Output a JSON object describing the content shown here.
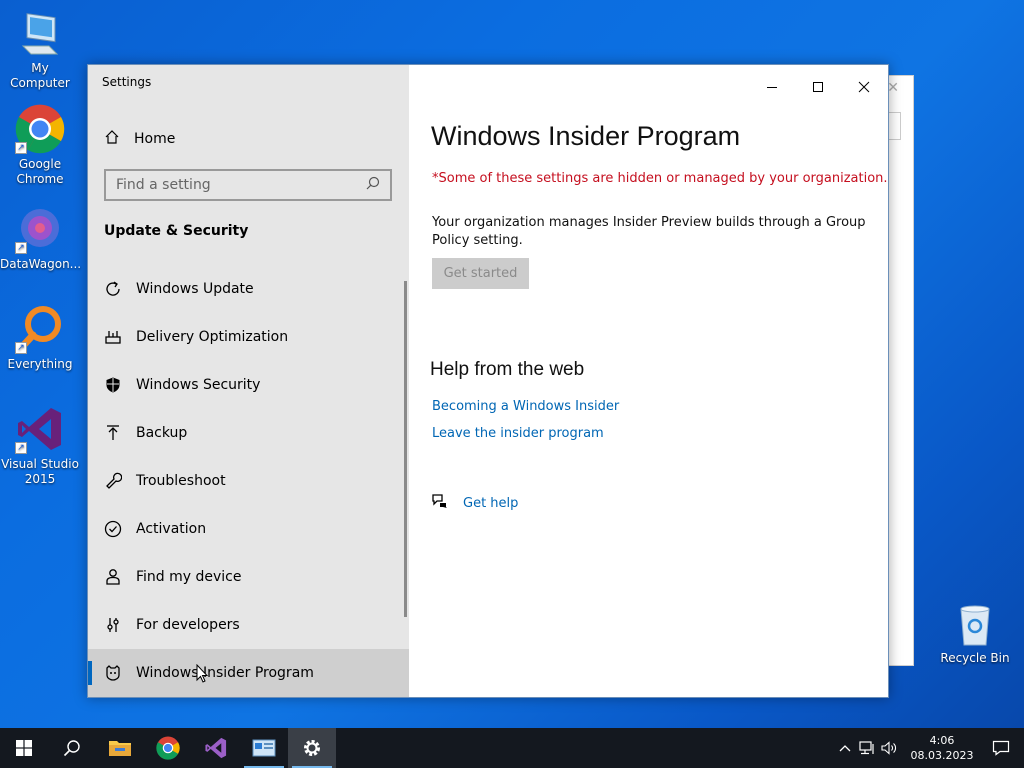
{
  "desktop": {
    "icons": [
      {
        "label": "My Computer"
      },
      {
        "label": "Google Chrome"
      },
      {
        "label": "DataWagon..."
      },
      {
        "label": "Everything"
      },
      {
        "label": "Visual Studio 2015"
      }
    ],
    "recycle_bin": "Recycle Bin"
  },
  "settings": {
    "window_title": "Settings",
    "home_label": "Home",
    "search_placeholder": "Find a setting",
    "section_title": "Update & Security",
    "nav": [
      {
        "label": "Windows Update",
        "icon": "refresh-icon"
      },
      {
        "label": "Delivery Optimization",
        "icon": "delivery-icon"
      },
      {
        "label": "Windows Security",
        "icon": "shield-icon"
      },
      {
        "label": "Backup",
        "icon": "backup-icon"
      },
      {
        "label": "Troubleshoot",
        "icon": "wrench-icon"
      },
      {
        "label": "Activation",
        "icon": "check-circle-icon"
      },
      {
        "label": "Find my device",
        "icon": "person-icon"
      },
      {
        "label": "For developers",
        "icon": "developer-icon"
      },
      {
        "label": "Windows Insider Program",
        "icon": "insider-icon",
        "selected": true
      }
    ],
    "content": {
      "title": "Windows Insider Program",
      "managed_notice": "*Some of these settings are hidden or managed by your organization.",
      "policy_text": "Your organization manages Insider Preview builds through a Group Policy setting.",
      "get_started_label": "Get started",
      "help_title": "Help from the web",
      "links": [
        "Becoming a Windows Insider",
        "Leave the insider program"
      ],
      "get_help_label": "Get help"
    }
  },
  "taskbar": {
    "clock_time": "4:06",
    "clock_date": "08.03.2023"
  },
  "colors": {
    "accent": "#0067c0",
    "link": "#0066b4",
    "warning": "#c50f1f",
    "taskbar": "#14181f"
  }
}
